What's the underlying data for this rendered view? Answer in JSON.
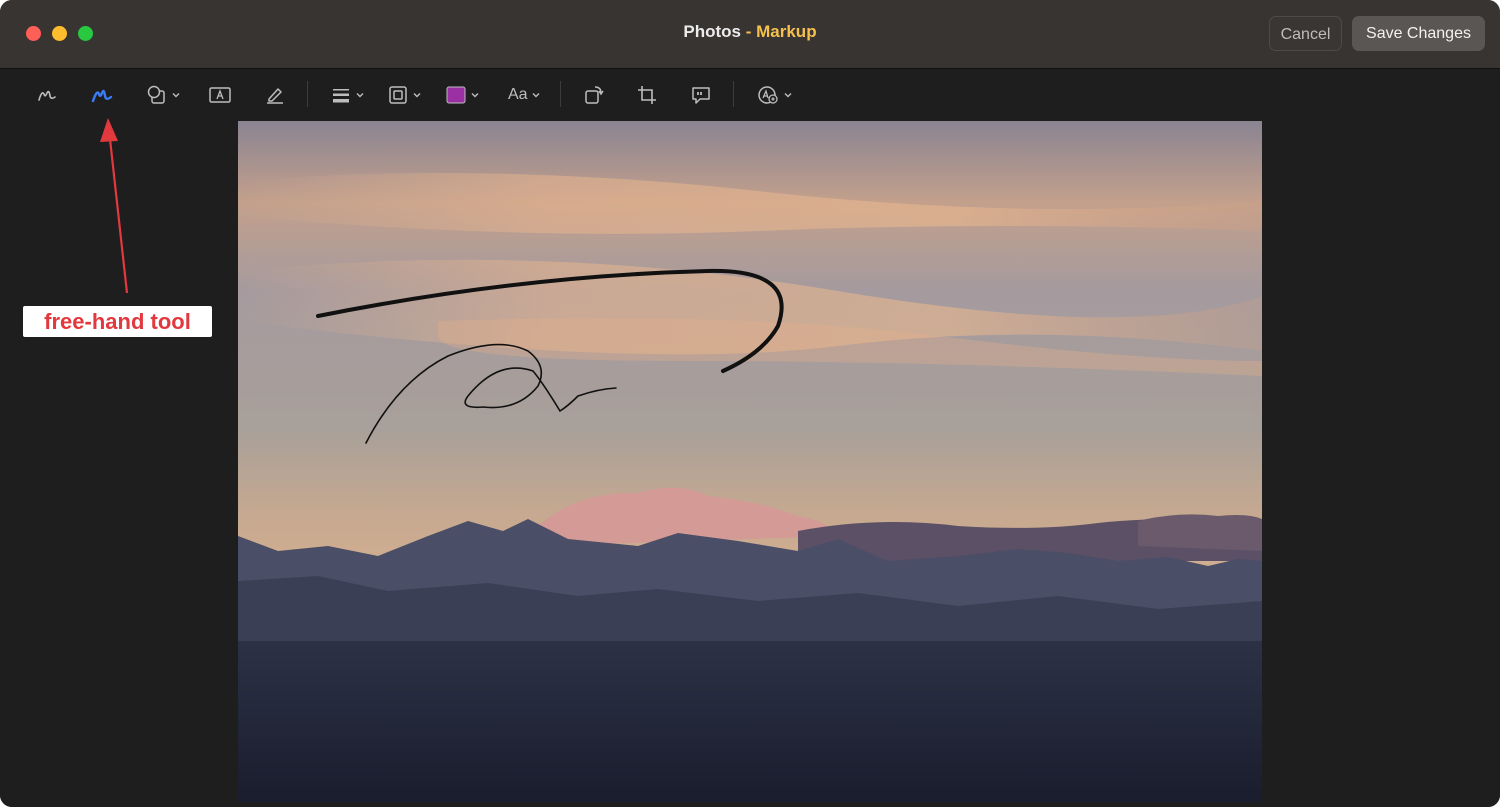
{
  "window": {
    "title_app": "Photos",
    "title_sep": " - ",
    "title_mode": "Markup",
    "cancel_label": "Cancel",
    "save_label": "Save Changes"
  },
  "toolbar": {
    "tools": [
      {
        "name": "sketch",
        "icon": "sketch-pen-icon"
      },
      {
        "name": "draw",
        "icon": "draw-pen-icon",
        "selected": true
      },
      {
        "name": "shapes",
        "icon": "shapes-icon"
      },
      {
        "name": "text",
        "icon": "text-box-icon"
      },
      {
        "name": "highlight",
        "icon": "highlighter-icon"
      },
      {
        "name": "shape-style",
        "icon": "line-weight-icon"
      },
      {
        "name": "border-color",
        "icon": "border-icon"
      },
      {
        "name": "fill-color",
        "icon": "color-swatch-icon"
      },
      {
        "name": "text-style",
        "icon": "text-style-icon"
      },
      {
        "name": "rotate",
        "icon": "rotate-icon"
      },
      {
        "name": "crop",
        "icon": "crop-icon"
      },
      {
        "name": "description",
        "icon": "speech-bubble-icon"
      },
      {
        "name": "signature",
        "icon": "signature-icon"
      }
    ],
    "text_style_label": "Aa",
    "fill_color": "#9b2fa4",
    "selected_color": "#3b7cf5"
  },
  "annotation": {
    "label": "free-hand tool",
    "color": "#e2393f"
  }
}
